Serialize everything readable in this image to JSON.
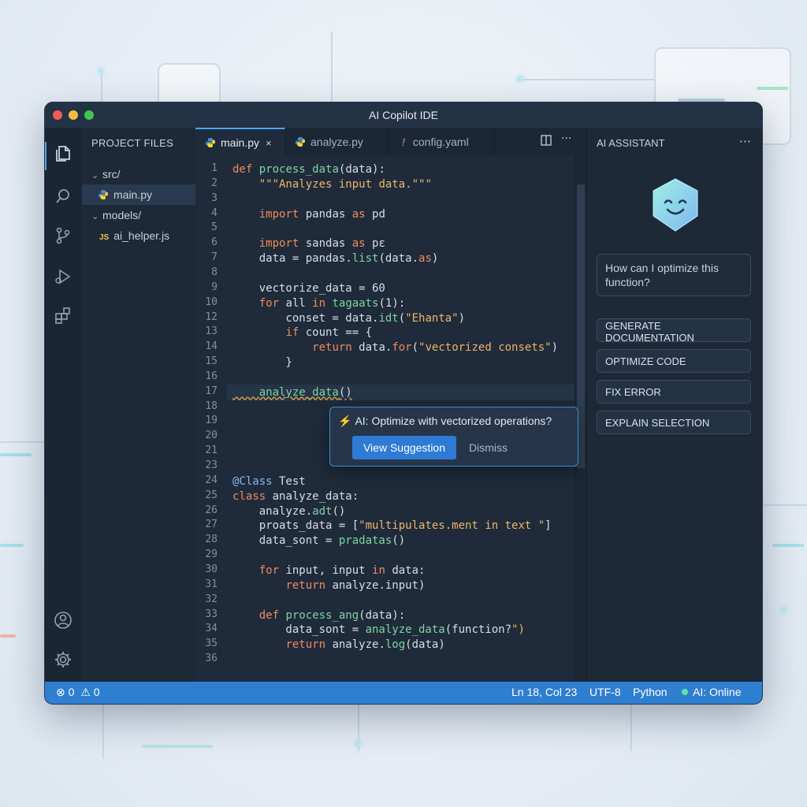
{
  "window": {
    "title": "AI Copilot IDE"
  },
  "explorer": {
    "title": "PROJECT FILES",
    "items": [
      {
        "label": "src/",
        "type": "folder"
      },
      {
        "label": "main.py",
        "type": "python"
      },
      {
        "label": "models/",
        "type": "folder"
      },
      {
        "label": "ai_helper.js",
        "type": "js",
        "badge": "JS"
      }
    ]
  },
  "tabs": [
    {
      "label": "main.py",
      "close": "×"
    },
    {
      "label": "analyze.py"
    },
    {
      "label": "config.yaml",
      "badge": "!"
    }
  ],
  "code": {
    "line_numbers": [
      "1",
      "2",
      "3",
      "4",
      "5",
      "6",
      "7",
      "8",
      "9",
      "10",
      "12",
      "13",
      "14",
      "15",
      "16",
      "17",
      "18",
      "19",
      "20",
      "21",
      "23",
      "24",
      "25",
      "26",
      "27",
      "28",
      "29",
      "30",
      "31",
      "32",
      "33",
      "34",
      "35",
      "36"
    ],
    "lines": [
      "def process_data(data):",
      "    \"\"\"Analyzes input data.\"\"\"",
      "",
      "    import pandas as pd",
      "",
      "    import sandas as pɛ",
      "    data = pandas.list(data.as)",
      "",
      "    vectorize_data = 60",
      "    for all in tagaats(1):",
      "        conset = data.idt(\"Ehanta\")",
      "        if count == {",
      "            return data.for(\"vectorized consets\")",
      "        }",
      "",
      "    analyze_data()",
      "",
      "",
      "",
      "",
      "",
      "@Class Test",
      "class analyze_data:",
      "    analyze.adt()",
      "    proats_data = [\"multipulates.ment in text \"]",
      "    data_sont = pradatas()",
      "",
      "    for input, input in data:",
      "        return analyze.input)",
      "",
      "    def process_ang(data):",
      "        data_sont = analyze_data(function?\")",
      "        return analyze.log(data)",
      ""
    ]
  },
  "suggestion": {
    "text": "AI: Optimize with vectorized operations?",
    "primary": "View Suggestion",
    "secondary": "Dismiss"
  },
  "assistant": {
    "title": "AI ASSISTANT",
    "more": "···",
    "prompt": "How can I optimize this function?",
    "actions": [
      "GENERATE DOCUMENTATION",
      "OPTIMIZE CODE",
      "FIX ERROR",
      "EXPLAIN SELECTION"
    ]
  },
  "status": {
    "problems": "0",
    "warnings": "0",
    "position": "Ln 18, Col 23",
    "encoding": "UTF-8",
    "language": "Python",
    "ai_status": "AI: Online"
  },
  "colors": {
    "accent": "#2f7fd1",
    "keyword": "#f08a5d",
    "function": "#7ed3a1",
    "string": "#f0b46a"
  }
}
